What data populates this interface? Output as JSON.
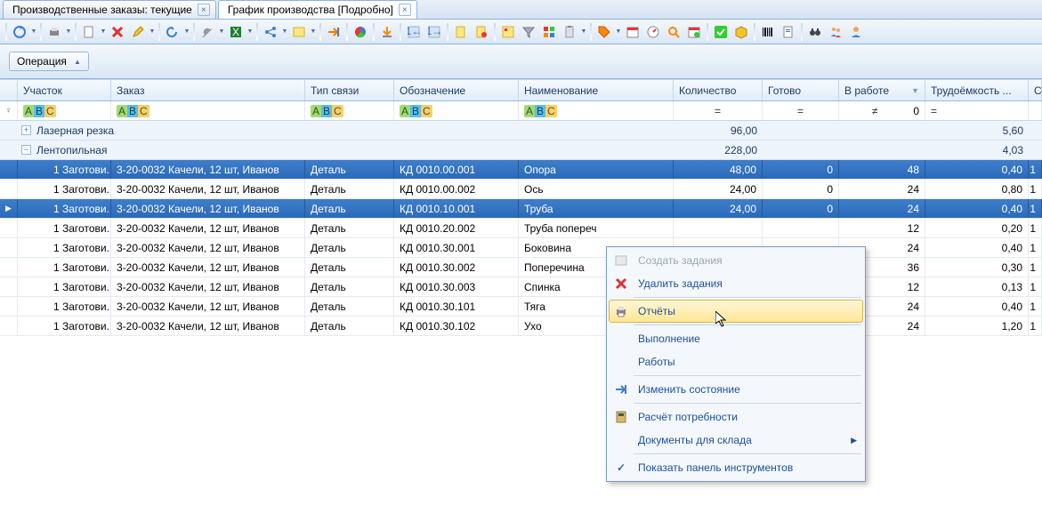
{
  "tabs": [
    {
      "label": "Производственные заказы: текущие",
      "active": false
    },
    {
      "label": "График производства [Подробно]",
      "active": true
    }
  ],
  "operation_button": "Операция",
  "columns": {
    "uchastok": "Участок",
    "zakaz": "Заказ",
    "tip": "Тип связи",
    "oboz": "Обозначение",
    "naim": "Наименование",
    "kol": "Количество",
    "got": "Готово",
    "vrab": "В работе",
    "trud": "Трудоёмкость ..."
  },
  "filter_ops": {
    "eq": "=",
    "neq": "≠",
    "zero": "0"
  },
  "groups": [
    {
      "name": "Лазерная резка",
      "expanded": false,
      "kol": "96,00",
      "trud": "5,60"
    },
    {
      "name": "Лентопильная",
      "expanded": true,
      "kol": "228,00",
      "trud": "4,03"
    }
  ],
  "rows": [
    {
      "sel": true,
      "uch": "1 Заготови...",
      "zakaz": "3-20-0032 Качели, 12 шт, Иванов",
      "tip": "Деталь",
      "oboz": "КД 0010.00.001",
      "naim": "Опора",
      "kol": "48,00",
      "got": "0",
      "vrab": "48",
      "trud": "0,40",
      "last": "1"
    },
    {
      "sel": false,
      "uch": "1 Заготови...",
      "zakaz": "3-20-0032 Качели, 12 шт, Иванов",
      "tip": "Деталь",
      "oboz": "КД 0010.00.002",
      "naim": "Ось",
      "kol": "24,00",
      "got": "0",
      "vrab": "24",
      "trud": "0,80",
      "last": "1"
    },
    {
      "sel": true,
      "uch": "1 Заготови...",
      "zakaz": "3-20-0032 Качели, 12 шт, Иванов",
      "tip": "Деталь",
      "oboz": "КД 0010.10.001",
      "naim": "Труба",
      "kol": "24,00",
      "got": "0",
      "vrab": "24",
      "trud": "0,40",
      "last": "1",
      "focused": true
    },
    {
      "sel": false,
      "uch": "1 Заготови...",
      "zakaz": "3-20-0032 Качели, 12 шт, Иванов",
      "tip": "Деталь",
      "oboz": "КД 0010.20.002",
      "naim": "Труба попереч",
      "kol": "",
      "got": "",
      "vrab": "12",
      "trud": "0,20",
      "last": "1"
    },
    {
      "sel": false,
      "uch": "1 Заготови...",
      "zakaz": "3-20-0032 Качели, 12 шт, Иванов",
      "tip": "Деталь",
      "oboz": "КД 0010.30.001",
      "naim": "Боковина",
      "kol": "",
      "got": "",
      "vrab": "24",
      "trud": "0,40",
      "last": "1"
    },
    {
      "sel": false,
      "uch": "1 Заготови...",
      "zakaz": "3-20-0032 Качели, 12 шт, Иванов",
      "tip": "Деталь",
      "oboz": "КД 0010.30.002",
      "naim": "Поперечина",
      "kol": "",
      "got": "",
      "vrab": "36",
      "trud": "0,30",
      "last": "1"
    },
    {
      "sel": false,
      "uch": "1 Заготови...",
      "zakaz": "3-20-0032 Качели, 12 шт, Иванов",
      "tip": "Деталь",
      "oboz": "КД 0010.30.003",
      "naim": "Спинка",
      "kol": "",
      "got": "",
      "vrab": "12",
      "trud": "0,13",
      "last": "1"
    },
    {
      "sel": false,
      "uch": "1 Заготови...",
      "zakaz": "3-20-0032 Качели, 12 шт, Иванов",
      "tip": "Деталь",
      "oboz": "КД 0010.30.101",
      "naim": "Тяга",
      "kol": "",
      "got": "",
      "vrab": "24",
      "trud": "0,40",
      "last": "1"
    },
    {
      "sel": false,
      "uch": "1 Заготови...",
      "zakaz": "3-20-0032 Качели, 12 шт, Иванов",
      "tip": "Деталь",
      "oboz": "КД 0010.30.102",
      "naim": "Ухо",
      "kol": "",
      "got": "",
      "vrab": "24",
      "trud": "1,20",
      "last": "1"
    }
  ],
  "context_menu": {
    "create": "Создать задания",
    "delete": "Удалить задания",
    "reports": "Отчёты",
    "execution": "Выполнение",
    "works": "Работы",
    "change_state": "Изменить состояние",
    "calc_demand": "Расчёт потребности",
    "warehouse_docs": "Документы для склада",
    "show_toolbar": "Показать панель инструментов"
  }
}
